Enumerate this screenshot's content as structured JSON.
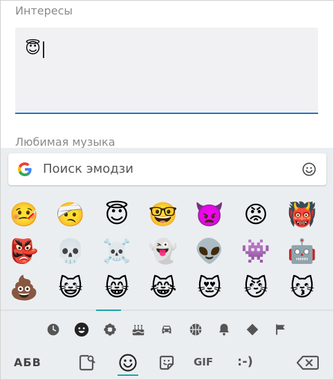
{
  "form": {
    "interests_label": "Интересы",
    "interests_value": "😇",
    "music_label": "Любимая музыка"
  },
  "keyboard": {
    "search_placeholder": "Поиск эмодзи",
    "emoji_rows": [
      [
        "🤒",
        "🤕",
        "😇",
        "🤓",
        "👿",
        "😡",
        "👹"
      ],
      [
        "👺",
        "💀",
        "☠️",
        "👻",
        "👽",
        "👾",
        "🤖"
      ],
      [
        "💩",
        "😺",
        "😸",
        "😹",
        "😻",
        "😼",
        "😽"
      ]
    ],
    "categories": [
      "recent-icon",
      "smileys-icon",
      "nature-icon",
      "food-icon",
      "travel-icon",
      "activity-icon",
      "objects-icon",
      "symbols-icon",
      "flags-icon"
    ],
    "bottom": {
      "abc_label": "АБВ",
      "gif_label": "GIF",
      "emoticon_label": ":-)"
    },
    "accent_color": "#18a4a9",
    "field_underline_color": "#1a73c9"
  }
}
